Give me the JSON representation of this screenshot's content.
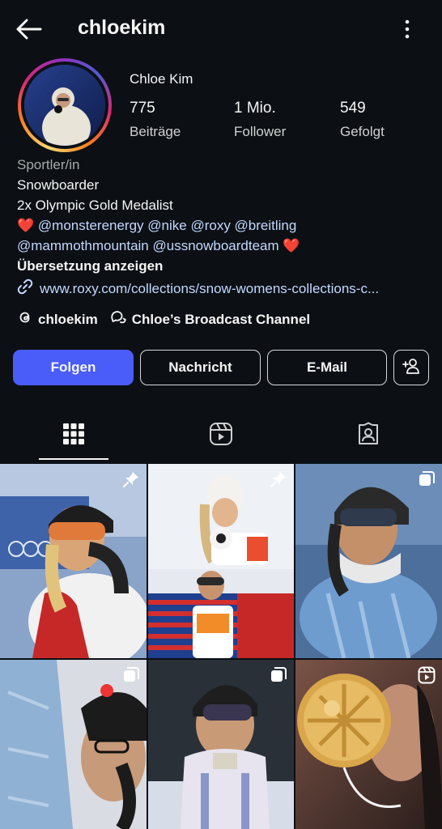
{
  "header": {
    "username": "chloekim"
  },
  "profile": {
    "full_name": "Chloe Kim",
    "stats": [
      {
        "value": "775",
        "label": "Beiträge"
      },
      {
        "value": "1 Mio.",
        "label": "Follower"
      },
      {
        "value": "549",
        "label": "Gefolgt"
      }
    ],
    "category": "Sportler/in",
    "bio": {
      "line1": "Snowboarder",
      "line2": "2x Olympic Gold Medalist",
      "line3": "@monsterenergy @nike @roxy @breitling",
      "line4": "@mammothmountain @ussnowboardteam",
      "heart": "❤️",
      "translate": "Übersetzung anzeigen"
    },
    "link": "www.roxy.com/collections/snow-womens-collections-c...",
    "threads_handle": "chloekim",
    "channel": "Chloe’s Broadcast Channel"
  },
  "actions": {
    "follow": "Folgen",
    "message": "Nachricht",
    "email": "E-Mail"
  },
  "tabs": [
    {
      "icon": "grid-icon",
      "active": true
    },
    {
      "icon": "reels-icon",
      "active": false
    },
    {
      "icon": "tagged-icon",
      "active": false
    }
  ],
  "posts": [
    {
      "overlay": "pin-icon"
    },
    {
      "overlay": "pin-icon"
    },
    {
      "overlay": "carousel-icon"
    },
    {
      "overlay": "carousel-icon"
    },
    {
      "overlay": "carousel-icon"
    },
    {
      "overlay": "reel-icon"
    }
  ],
  "colors": {
    "background": "#0c1014",
    "primary_button": "#4a5df9",
    "link": "#c3d7ff"
  }
}
